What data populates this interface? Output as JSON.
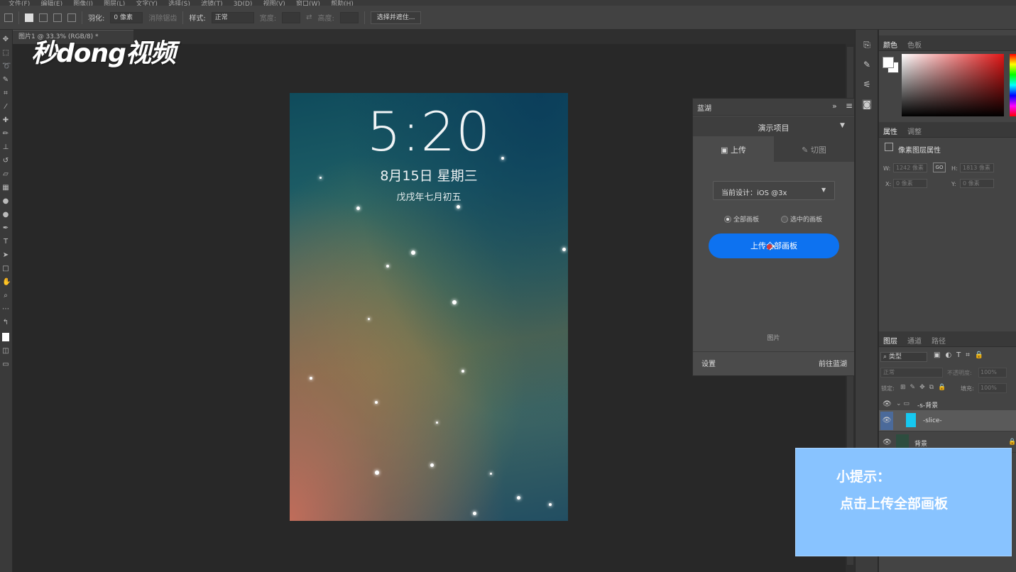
{
  "app": {
    "menu": [
      "文件(F)",
      "编辑(E)",
      "图像(I)",
      "图层(L)",
      "文字(Y)",
      "选择(S)",
      "滤镜(T)",
      "3D(D)",
      "视图(V)",
      "窗口(W)",
      "帮助(H)"
    ]
  },
  "options_bar": {
    "feather_label": "羽化:",
    "feather_value": "0 像素",
    "antialias_label": "消除锯齿",
    "style_label": "样式:",
    "style_value": "正常",
    "width_label": "宽度:",
    "height_label": "高度:",
    "select_mask_button": "选择并遮住..."
  },
  "document_tab": {
    "title": "图片1 @ 33.3% (RGB/8) *"
  },
  "logo": {
    "text": "秒dong视频"
  },
  "artboard": {
    "time": "5:20",
    "date": "8月15日 星期三",
    "lunar": "戊戌年七月初五"
  },
  "lanhu_panel": {
    "title": "蓝湖",
    "project": "演示项目",
    "tab_upload": "上传",
    "tab_slice": "切图",
    "design_label": "当前设计：iOS @3x",
    "radio_all": "全部画板",
    "radio_selected": "选中的画板",
    "upload_button": "上传全部画板",
    "image_label": "图片",
    "settings": "设置",
    "goto": "前往蓝湖"
  },
  "color_panel": {
    "tab_color": "颜色",
    "tab_swatches": "色板"
  },
  "properties_panel": {
    "tab_properties": "属性",
    "tab_adjustments": "调整",
    "title": "像素图层属性",
    "w_label": "W:",
    "w_value": "1242 像素",
    "h_label": "H:",
    "h_value": "1813 像素",
    "x_label": "X:",
    "x_value": "0 像素",
    "y_label": "Y:",
    "y_value": "0 像素",
    "link_label": "GO"
  },
  "layers_panel": {
    "tab_layers": "图层",
    "tab_channels": "通道",
    "tab_paths": "路径",
    "filter_kind": "类型",
    "blend_mode": "正常",
    "opacity_label": "不透明度:",
    "opacity_value": "100%",
    "lock_label": "锁定:",
    "fill_label": "填充:",
    "fill_value": "100%",
    "layers": [
      {
        "name": "-s-背景",
        "type": "group"
      },
      {
        "name": "-slice-",
        "type": "layer"
      },
      {
        "name": "背景",
        "type": "background"
      }
    ]
  },
  "tip": {
    "title": "小提示：",
    "body": "点击上传全部画板"
  },
  "colors": {
    "upload_button": "#0d72f0",
    "tip_background": "#88c3ff"
  }
}
